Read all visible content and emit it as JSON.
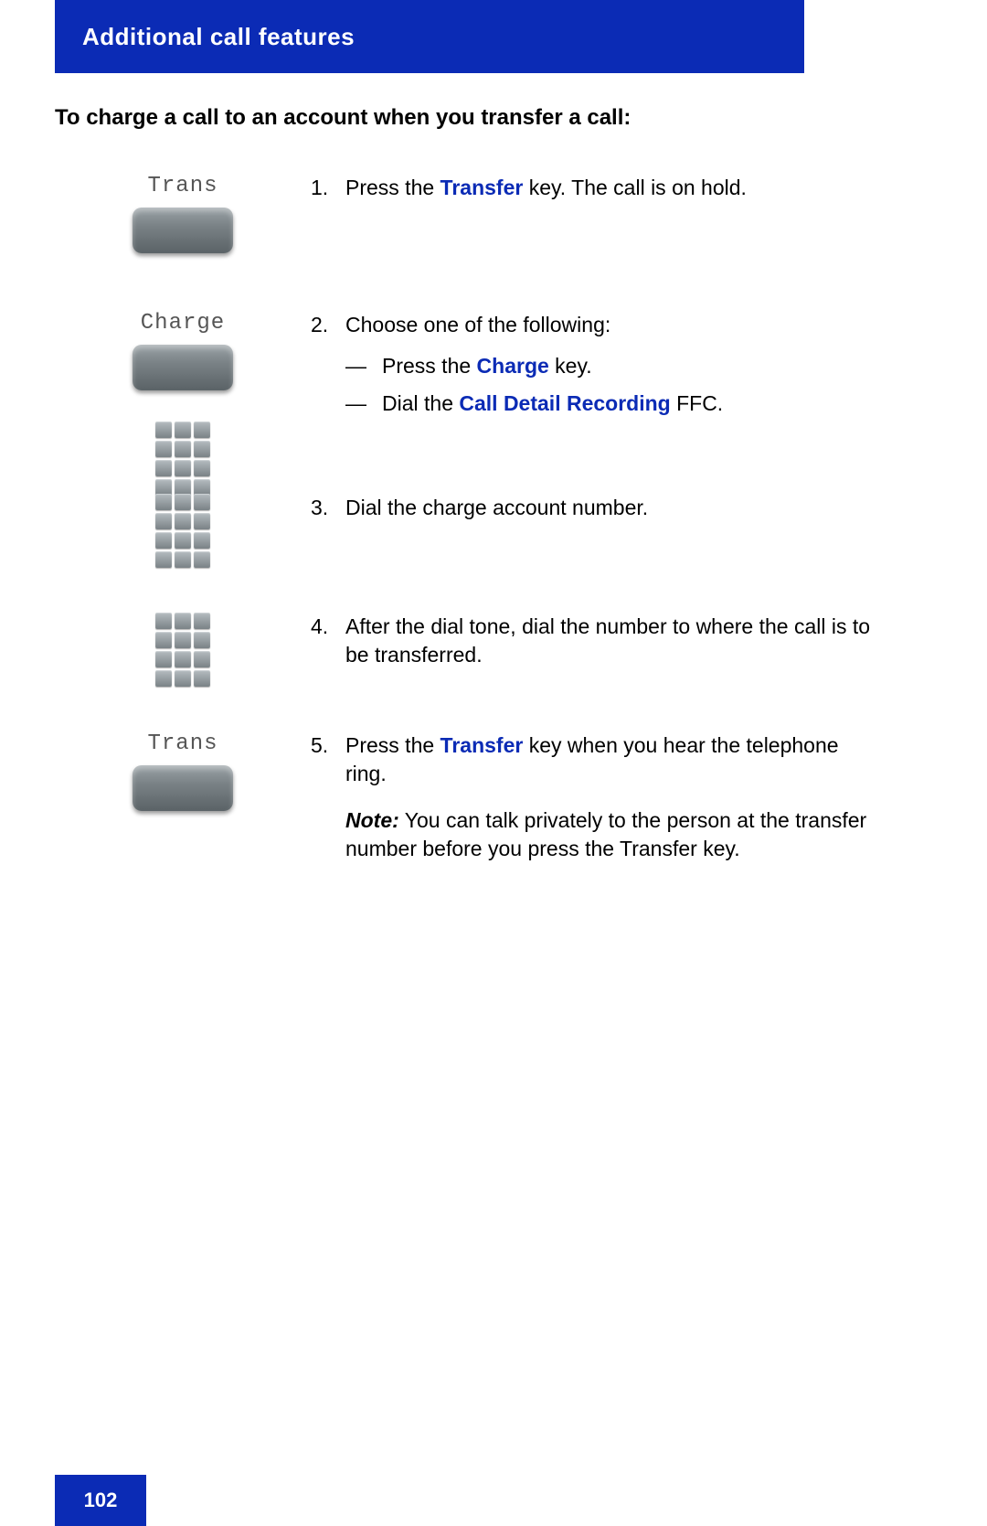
{
  "header": {
    "title": "Additional call features"
  },
  "section_title": "To charge a call to an account when you transfer a call:",
  "steps": {
    "s1": {
      "label": "Trans",
      "num": "1.",
      "pre": "Press the ",
      "hl": "Transfer",
      "post": " key. The call is on hold."
    },
    "s2": {
      "label": "Charge",
      "num": "2.",
      "intro": "Choose one of the following:",
      "a_pre": "Press the ",
      "a_hl": "Charge",
      "a_post": " key.",
      "b_pre": "Dial the ",
      "b_hl": "Call Detail Recording",
      "b_post": " FFC."
    },
    "s3": {
      "num": "3.",
      "text": "Dial the charge account number."
    },
    "s4": {
      "num": "4.",
      "text": "After the dial tone, dial the number to where the call is to be transferred."
    },
    "s5": {
      "label": "Trans",
      "num": "5.",
      "pre": "Press the ",
      "hl": "Transfer",
      "post": " key when you hear the telephone ring.",
      "note_label": "Note:",
      "note": " You can talk privately to the person at the transfer number before you press the Transfer key."
    }
  },
  "footer": {
    "page": "102"
  }
}
